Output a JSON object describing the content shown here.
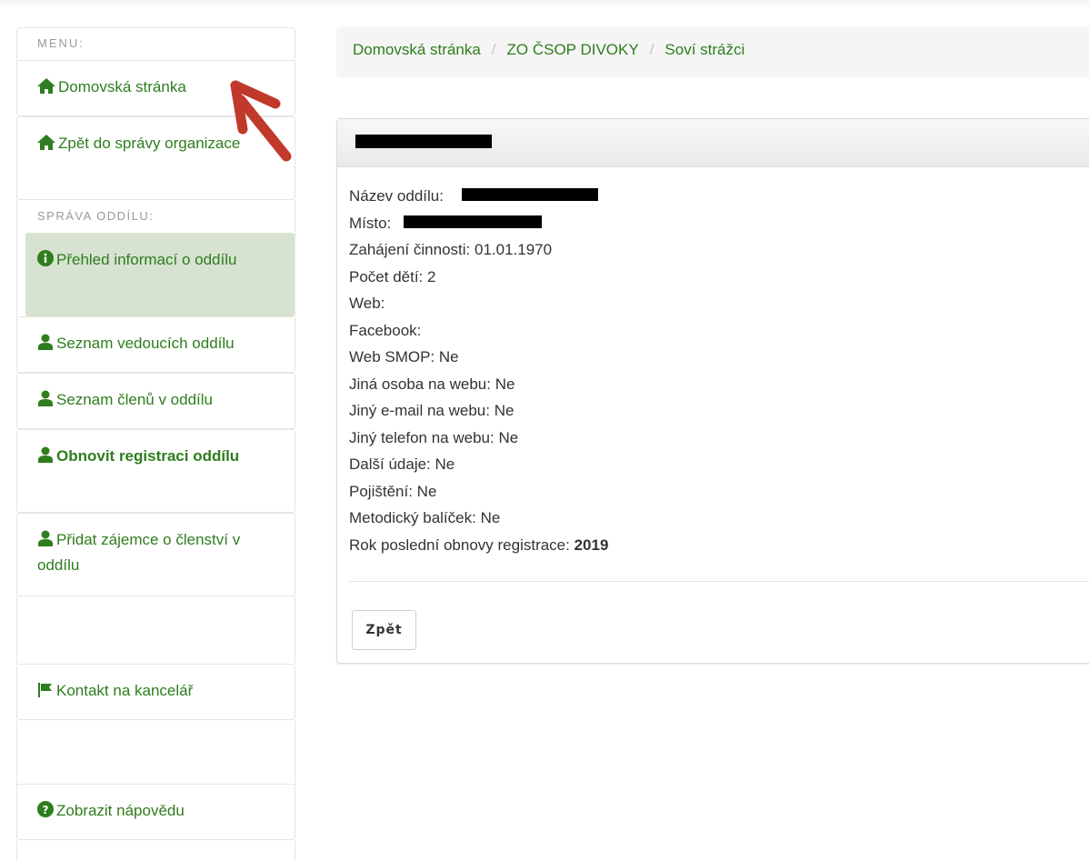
{
  "sidebar": {
    "menu_header": "MENU:",
    "section_header": "SPRÁVA ODDÍLU:",
    "items": [
      {
        "label": "Domovská stránka",
        "icon": "home-icon"
      },
      {
        "label": "Zpět do správy organizace",
        "icon": "home-icon"
      },
      {
        "label": "Přehled informací o oddílu",
        "icon": "info-circle-icon"
      },
      {
        "label": "Seznam vedoucích oddílu",
        "icon": "user-icon"
      },
      {
        "label": "Seznam členů v oddílu",
        "icon": "user-icon"
      },
      {
        "label": "Obnovit registraci oddílu",
        "icon": "user-icon"
      },
      {
        "label": "Přidat zájemce o členství v oddílu",
        "icon": "user-icon"
      },
      {
        "label": "Kontakt na kancelář",
        "icon": "flag-icon"
      },
      {
        "label": "Zobrazit nápovědu",
        "icon": "question-circle-icon"
      }
    ]
  },
  "breadcrumb": {
    "items": [
      "Domovská stránka",
      "ZO ČSOP DIVOKY",
      "Soví strážci"
    ],
    "separator": "/"
  },
  "panel": {
    "fields": [
      {
        "label": "Název oddílu:",
        "value": ""
      },
      {
        "label": "Místo:",
        "value": ""
      },
      {
        "label": "Zahájení činnosti:",
        "value": "01.01.1970"
      },
      {
        "label": "Počet dětí:",
        "value": "2"
      },
      {
        "label": "Web:",
        "value": ""
      },
      {
        "label": "Facebook:",
        "value": ""
      },
      {
        "label": "Web SMOP:",
        "value": "Ne"
      },
      {
        "label": "Jiná osoba na webu:",
        "value": "Ne"
      },
      {
        "label": "Jiný e-mail na webu:",
        "value": "Ne"
      },
      {
        "label": "Jiný telefon na webu:",
        "value": "Ne"
      },
      {
        "label": "Další údaje:",
        "value": "Ne"
      },
      {
        "label": "Pojištění:",
        "value": "Ne"
      },
      {
        "label": "Metodický balíček:",
        "value": "Ne"
      },
      {
        "label": "Rok poslední obnovy registrace:",
        "value": "2019"
      }
    ],
    "back_button": "Zpět"
  },
  "colors": {
    "link_green": "#2e7d1e",
    "active_bg": "#d7e2d0",
    "annotation_arrow": "#c0392b"
  }
}
